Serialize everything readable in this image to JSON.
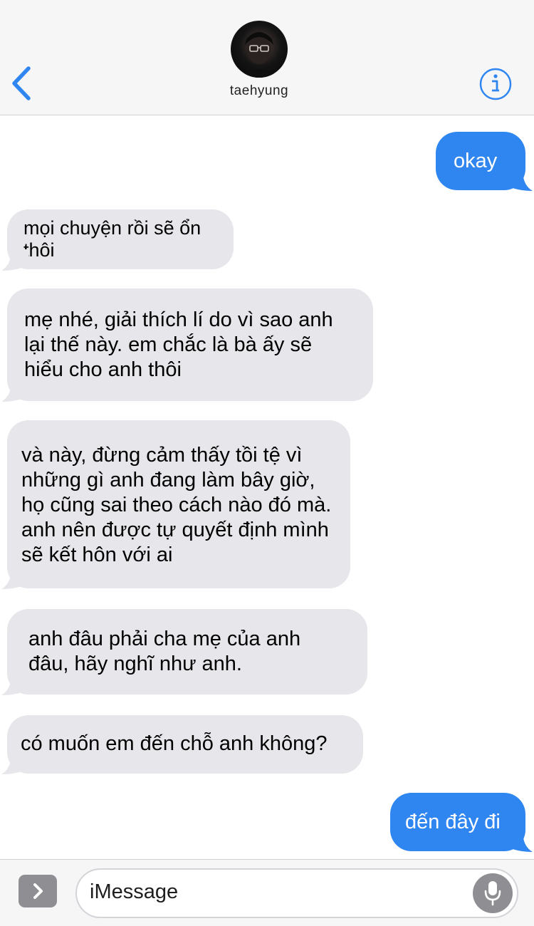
{
  "header": {
    "contact_name": "taehyung",
    "back_icon": "chevron-left-icon",
    "info_icon": "info-icon",
    "accent_color": "#2f86f1"
  },
  "messages": [
    {
      "direction": "outgoing",
      "text": "okay"
    },
    {
      "direction": "incoming",
      "text": "mọi chuyện rồi sẽ ổn thôi"
    },
    {
      "direction": "incoming",
      "text": "mẹ nhé, giải thích lí do vì sao anh lại thế này. em chắc là bà ấy sẽ hiểu cho anh thôi"
    },
    {
      "direction": "incoming",
      "text": "và này, đừng cảm thấy tồi tệ vì những gì anh đang làm bây giờ, họ cũng sai theo cách nào đó mà. anh nên được tự quyết định mình sẽ kết hôn với ai"
    },
    {
      "direction": "incoming",
      "text": "anh đâu phải cha mẹ của anh đâu, hãy nghĩ như anh."
    },
    {
      "direction": "incoming",
      "text": "có muốn em đến chỗ anh không?"
    },
    {
      "direction": "outgoing",
      "text": "đến đây đi"
    }
  ],
  "composer": {
    "placeholder": "iMessage",
    "expand_icon": "chevron-right-icon",
    "mic_icon": "microphone-icon"
  }
}
